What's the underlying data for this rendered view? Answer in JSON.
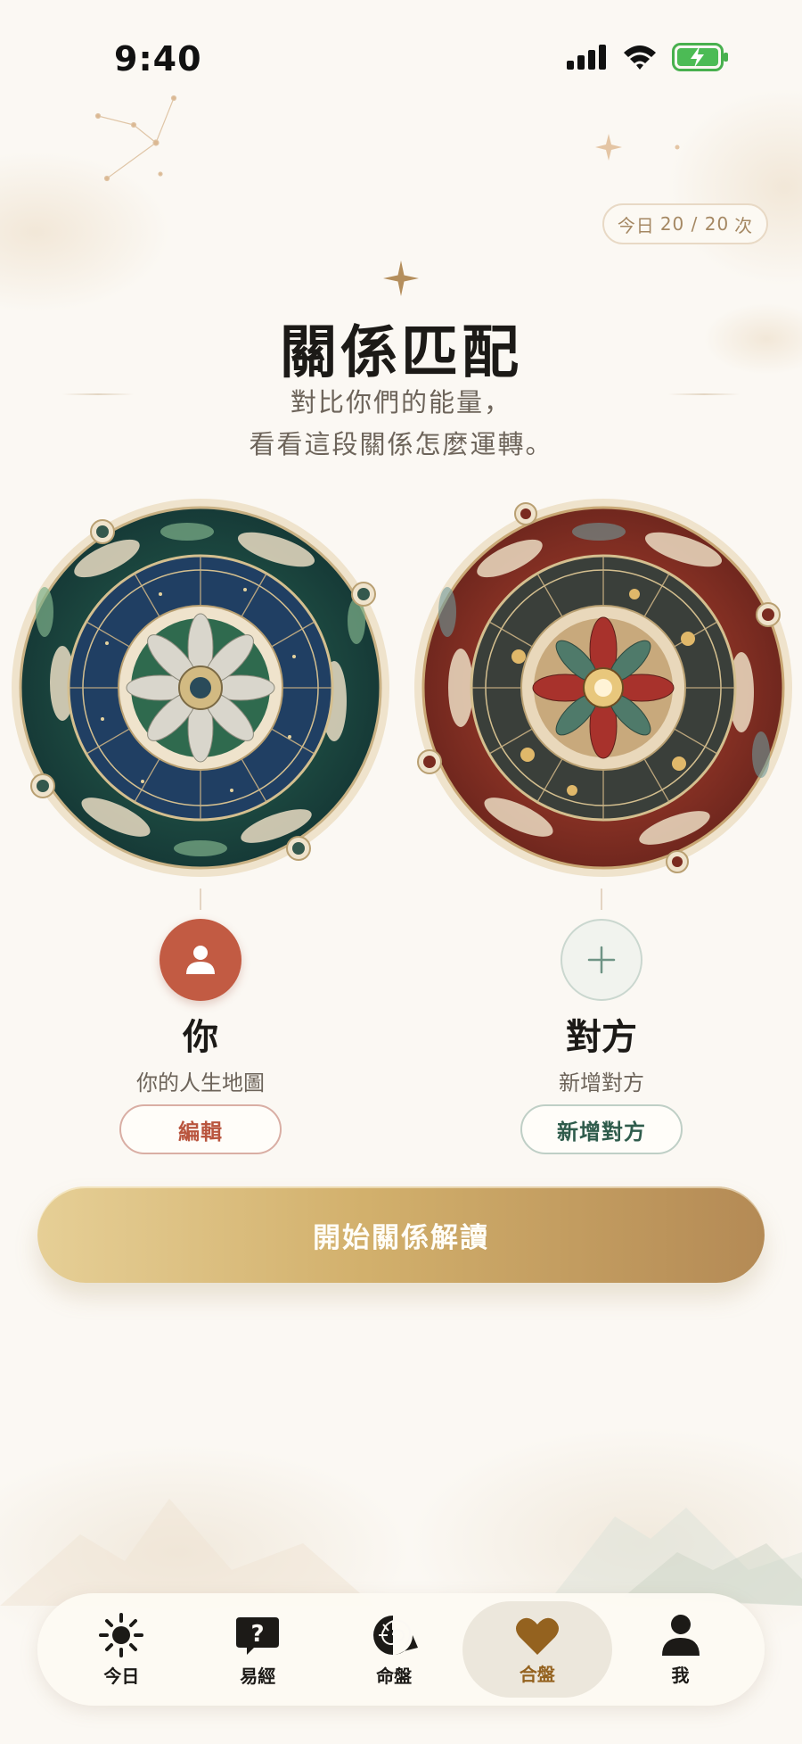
{
  "status_bar": {
    "time": "9:40"
  },
  "quota": {
    "prefix": "今日",
    "count": "20 / 20",
    "unit": "次"
  },
  "header": {
    "title": "關係匹配",
    "subtitle_line1": "對比你們的能量，",
    "subtitle_line2": "看看這段關係怎麼運轉。"
  },
  "profiles": {
    "you": {
      "name": "你",
      "subtitle": "你的人生地圖",
      "button": "編輯"
    },
    "partner": {
      "name": "對方",
      "subtitle": "新增對方",
      "button": "新增對方"
    }
  },
  "cta": {
    "label": "開始關係解讀"
  },
  "tabs": [
    {
      "label": "今日",
      "icon": "sun-icon"
    },
    {
      "label": "易經",
      "icon": "question-bubble-icon"
    },
    {
      "label": "命盤",
      "icon": "nautilus-shell-icon"
    },
    {
      "label": "合盤",
      "icon": "heart-icon",
      "active": true
    },
    {
      "label": "我",
      "icon": "person-icon"
    }
  ],
  "colors": {
    "background": "#fbf8f3",
    "accent_red": "#c25b43",
    "accent_green": "#2f5c4c",
    "gold": "#c9a565",
    "active_tab": "#94621f"
  }
}
